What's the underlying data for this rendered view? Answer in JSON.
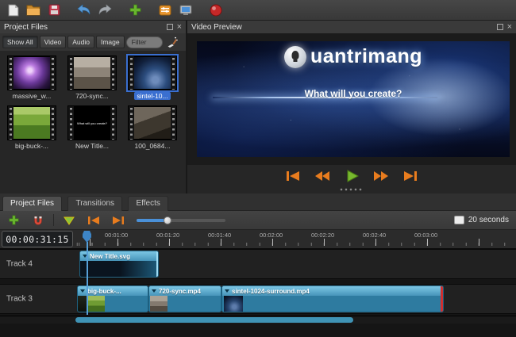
{
  "toolbar": {
    "buttons": [
      {
        "name": "new-project"
      },
      {
        "name": "open-project"
      },
      {
        "name": "save-project"
      },
      {
        "name": "undo"
      },
      {
        "name": "redo"
      },
      {
        "name": "import-files"
      },
      {
        "name": "choose-profile"
      },
      {
        "name": "fullscreen"
      },
      {
        "name": "export-video"
      }
    ]
  },
  "project_files": {
    "title": "Project Files",
    "filter_buttons": [
      "Show All",
      "Video",
      "Audio",
      "Image"
    ],
    "filter_placeholder": "Filter",
    "files": [
      {
        "label": "massive_w...",
        "selected": false
      },
      {
        "label": "720-sync...",
        "selected": false
      },
      {
        "label": "sintel-10...",
        "selected": true
      },
      {
        "label": "big-buck-...",
        "selected": false
      },
      {
        "label": "New Title...",
        "selected": false,
        "thumb_text": "What will you create?"
      },
      {
        "label": "100_0684...",
        "selected": false
      }
    ]
  },
  "video_preview": {
    "title": "Video Preview",
    "watermark": "uantrimang",
    "watermark_icon": "lightbulb-icon",
    "overlay_text": "What will you create?",
    "transport": [
      "jump-to-start",
      "rewind",
      "play",
      "fast-forward",
      "jump-to-end"
    ]
  },
  "tabs": [
    {
      "label": "Project Files",
      "active": true
    },
    {
      "label": "Transitions",
      "active": false
    },
    {
      "label": "Effects",
      "active": false
    }
  ],
  "timeline": {
    "toolbar_icons": [
      "add-track",
      "snapping",
      "add-marker",
      "previous-marker",
      "next-marker",
      "zoom-slider"
    ],
    "zoom_label": "20 seconds",
    "timecode": "00:00:31:15",
    "ruler_marks": [
      "00:01:00",
      "00:01:20",
      "00:01:40",
      "00:02:00",
      "00:02:20",
      "00:02:40",
      "00:03:00"
    ],
    "tracks": [
      {
        "name": "Track 4",
        "clips": [
          {
            "label": "New Title.svg"
          }
        ]
      },
      {
        "name": "Track 3",
        "clips": [
          {
            "label": "big-buck-..."
          },
          {
            "label": "720-sync.mp4"
          },
          {
            "label": "sintel-1024-surround.mp4"
          }
        ]
      }
    ]
  },
  "colors": {
    "clip_blue": "#4aa0c6",
    "clip_header_blue": "#5cb2d8",
    "playhead_blue": "#4a90d8",
    "transport_orange": "#e87c1e",
    "play_green": "#77b82e",
    "selection_blue": "#3a6fd0",
    "record_red": "#c62828",
    "trim_red": "#d03030"
  }
}
